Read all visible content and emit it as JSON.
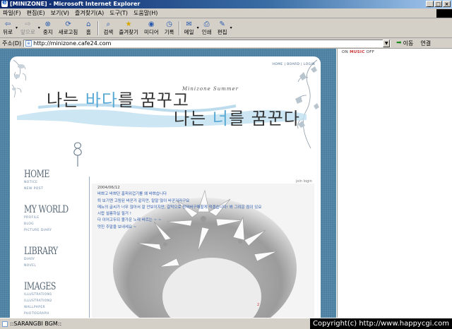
{
  "window": {
    "title": "[MINIZONE] - Microsoft Internet Explorer",
    "controls": [
      "_",
      "□",
      "×"
    ]
  },
  "menu": [
    "파일(F)",
    "편집(E)",
    "보기(V)",
    "즐겨찾기(A)",
    "도구(T)",
    "도움말(H)"
  ],
  "toolbar": {
    "back": "뒤로",
    "forward": "앞으로",
    "stop": "중지",
    "refresh": "새로고침",
    "home": "홈",
    "search": "검색",
    "favorites": "즐겨찾기",
    "media": "미디어",
    "history": "기록",
    "mail": "메일",
    "print": "인쇄",
    "edit": "편집"
  },
  "address": {
    "label": "주소(D)",
    "url": "http://minizone.cafe24.com",
    "go": "이동",
    "links": "연결"
  },
  "site": {
    "toplinks": "HOME  |  BOARD  |  LOGIN",
    "heading_line1": "나는 바다를 꿈꾸고",
    "heading_line2": "나는 너를 꿈꾼다",
    "brand": "Minizone Summer",
    "join_login": "join  login",
    "nav": [
      {
        "title": "HOME",
        "items": [
          "NOTICE",
          "NEW POST"
        ]
      },
      {
        "title": "MY WORLD",
        "items": [
          "PROFILE",
          "BLOG",
          "PICTURE DIARY"
        ]
      },
      {
        "title": "LIBRARY",
        "items": [
          "DIARY",
          "NOVEL"
        ]
      },
      {
        "title": "IMAGES",
        "items": [
          "ILLUSTRATION1",
          "ILLUSTRATION2",
          "WALLPAPER",
          "PHOTOGRAPH"
        ]
      }
    ],
    "post": {
      "date": "2004/06/12",
      "lines": [
        "바쁘고 바쁘던 홈피위겁기를 왜 바쁘습니다",
        "퇴 보기엔 고림된 바꾼거 같지만, 말말 많이 바꾼거라구요",
        "메뉴의 글씨가 너무 많아서 잘 안보이지만, 갈막으로 방꺼버구매할게 적겠습니다! 봐 그려운 점이 있요",
        "시랍 설름하실 필거 !",
        "다 이어고두되 볼가운 노래 바르는 ~ ~",
        "멋진 주말을 보내세요 ~"
      ]
    },
    "page_number": "2"
  },
  "side": {
    "music_prefix": "ON ",
    "music_label": "MUSIC",
    "music_suffix": " OFF"
  },
  "status": {
    "text": "::SARANGBI BGM::",
    "copyright": "Copyright(c) http://www.happycgi.com"
  }
}
